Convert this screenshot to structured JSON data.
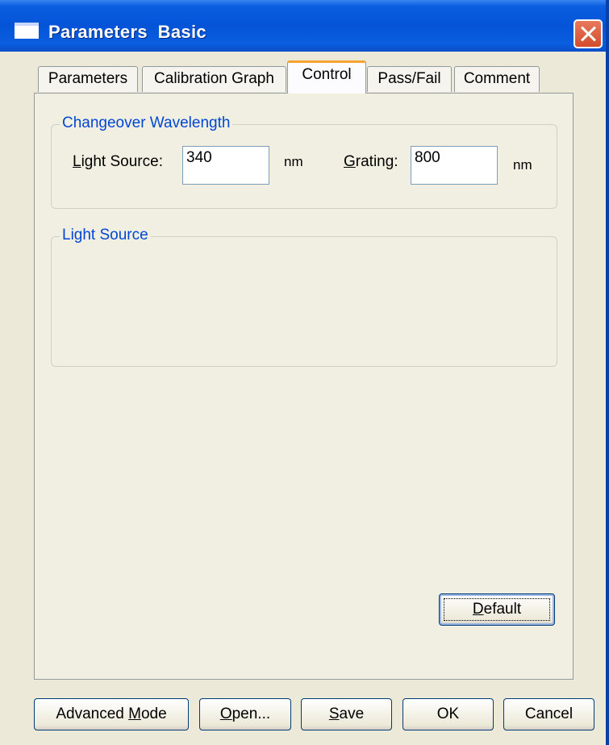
{
  "window": {
    "title": "Parameters  Basic"
  },
  "tabs": [
    {
      "label": "Parameters"
    },
    {
      "label": "Calibration Graph"
    },
    {
      "label": "Control"
    },
    {
      "label": "Pass/Fail"
    },
    {
      "label": "Comment"
    }
  ],
  "active_tab": "Control",
  "changeover": {
    "title": "Changeover Wavelength",
    "light_source_label_u": "L",
    "light_source_label_rest": "ight Source:",
    "light_source_value": "340",
    "light_source_unit": "nm",
    "grating_label_u": "G",
    "grating_label_rest": "rating:",
    "grating_value": "800",
    "grating_unit": "nm"
  },
  "light_source_group": {
    "title": "Light Source"
  },
  "default_button": {
    "u": "D",
    "rest": "efault"
  },
  "bottom_buttons": {
    "advanced_pre": "Advanced ",
    "advanced_u": "M",
    "advanced_rest": "ode",
    "open_u": "O",
    "open_rest": "pen...",
    "save_u": "S",
    "save_rest": "ave",
    "ok": "OK",
    "cancel": "Cancel"
  },
  "colors": {
    "accent": "#0046d5",
    "titlebar": "#0553d8",
    "tab_highlight": "#f5a431"
  }
}
